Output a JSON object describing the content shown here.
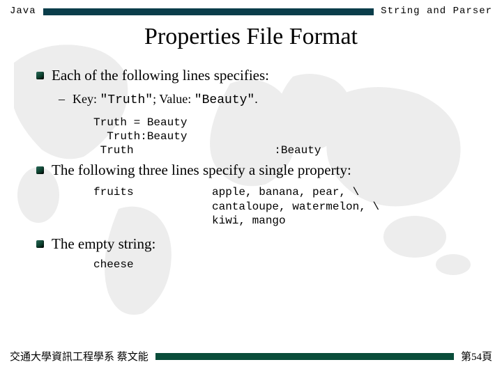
{
  "header": {
    "left": "Java",
    "right": "String and Parser"
  },
  "title": "Properties File Format",
  "bullets": {
    "b1": "Each of the following lines specifies:",
    "b1_sub_text": "Key: ",
    "b1_sub_key": "\"Truth\"",
    "b1_sub_mid": ";  Value: ",
    "b1_sub_val": "\"Beauty\"",
    "b1_sub_end": ".",
    "code1": "Truth = Beauty\n  Truth:Beauty\n Truth                     :Beauty",
    "b2": "The following three lines specify a single property:",
    "code2_left": "fruits",
    "code2_right": "apple, banana, pear, \\\ncantaloupe, watermelon, \\\nkiwi, mango",
    "b3": "The empty string:",
    "code3": "cheese"
  },
  "footer": {
    "left": "交通大學資訊工程學系 蔡文能",
    "right": "第54頁"
  }
}
